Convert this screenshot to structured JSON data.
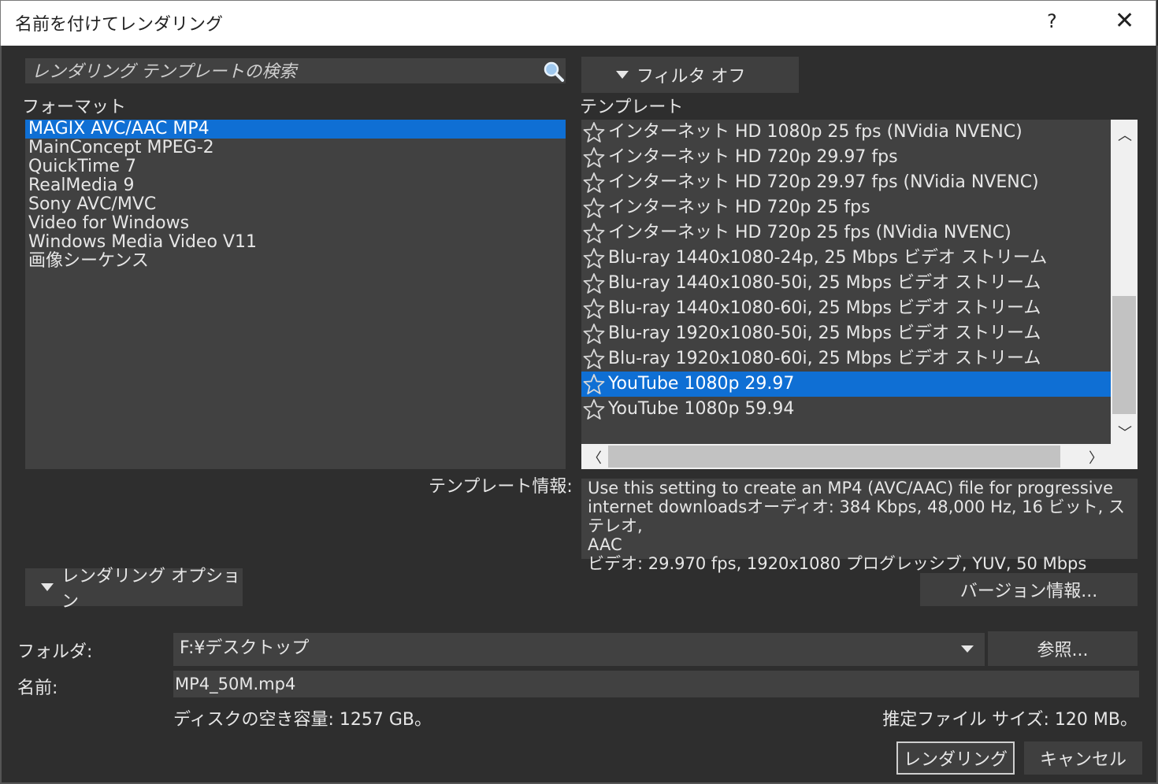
{
  "window": {
    "title": "名前を付けてレンダリング",
    "help_label": "?",
    "close_label": "✕"
  },
  "search": {
    "placeholder": "レンダリング テンプレートの検索"
  },
  "filter": {
    "label": "フィルタ オフ"
  },
  "format": {
    "label": "フォーマット",
    "items": [
      "MAGIX AVC/AAC MP4",
      "MainConcept MPEG-2",
      "QuickTime 7",
      "RealMedia 9",
      "Sony AVC/MVC",
      "Video for Windows",
      "Windows Media Video V11",
      "画像シーケンス"
    ],
    "selected_index": 0
  },
  "template": {
    "label": "テンプレート",
    "items": [
      "インターネット HD 1080p 25 fps (NVidia NVENC)",
      "インターネット HD 720p 29.97 fps",
      "インターネット HD 720p 29.97 fps (NVidia NVENC)",
      "インターネット HD 720p 25 fps",
      "インターネット HD 720p 25 fps (NVidia NVENC)",
      "Blu-ray 1440x1080-24p, 25 Mbps ビデオ ストリーム",
      "Blu-ray 1440x1080-50i, 25 Mbps ビデオ ストリーム",
      "Blu-ray 1440x1080-60i, 25 Mbps ビデオ ストリーム",
      "Blu-ray 1920x1080-50i, 25 Mbps ビデオ ストリーム",
      "Blu-ray 1920x1080-60i, 25 Mbps ビデオ ストリーム",
      "YouTube 1080p 29.97",
      "YouTube 1080p 59.94"
    ],
    "selected_index": 10
  },
  "template_info": {
    "label": "テンプレート情報:",
    "lines": [
      "Use this setting to create an MP4 (AVC/AAC) file for progressive",
      "internet downloadsオーディオ: 384 Kbps, 48,000 Hz, 16 ビット, ステレオ,",
      "AAC",
      "ビデオ: 29.970 fps, 1920x1080 プログレッシブ, YUV, 50 Mbps"
    ]
  },
  "buttons": {
    "render_options": "レンダリング オプション",
    "version_info": "バージョン情報...",
    "browse": "参照...",
    "render": "レンダリング",
    "cancel": "キャンセル"
  },
  "folder": {
    "label": "フォルダ:",
    "value": "F:¥デスクトップ"
  },
  "name": {
    "label": "名前:",
    "value": "MP4_50M.mp4"
  },
  "disk_free": "ディスクの空き容量: 1257 GB。",
  "estimated_size": "推定ファイル サイズ: 120 MB。",
  "colors": {
    "selection": "#0f6fd4",
    "panel": "#414141",
    "background": "#2e2e2e"
  }
}
